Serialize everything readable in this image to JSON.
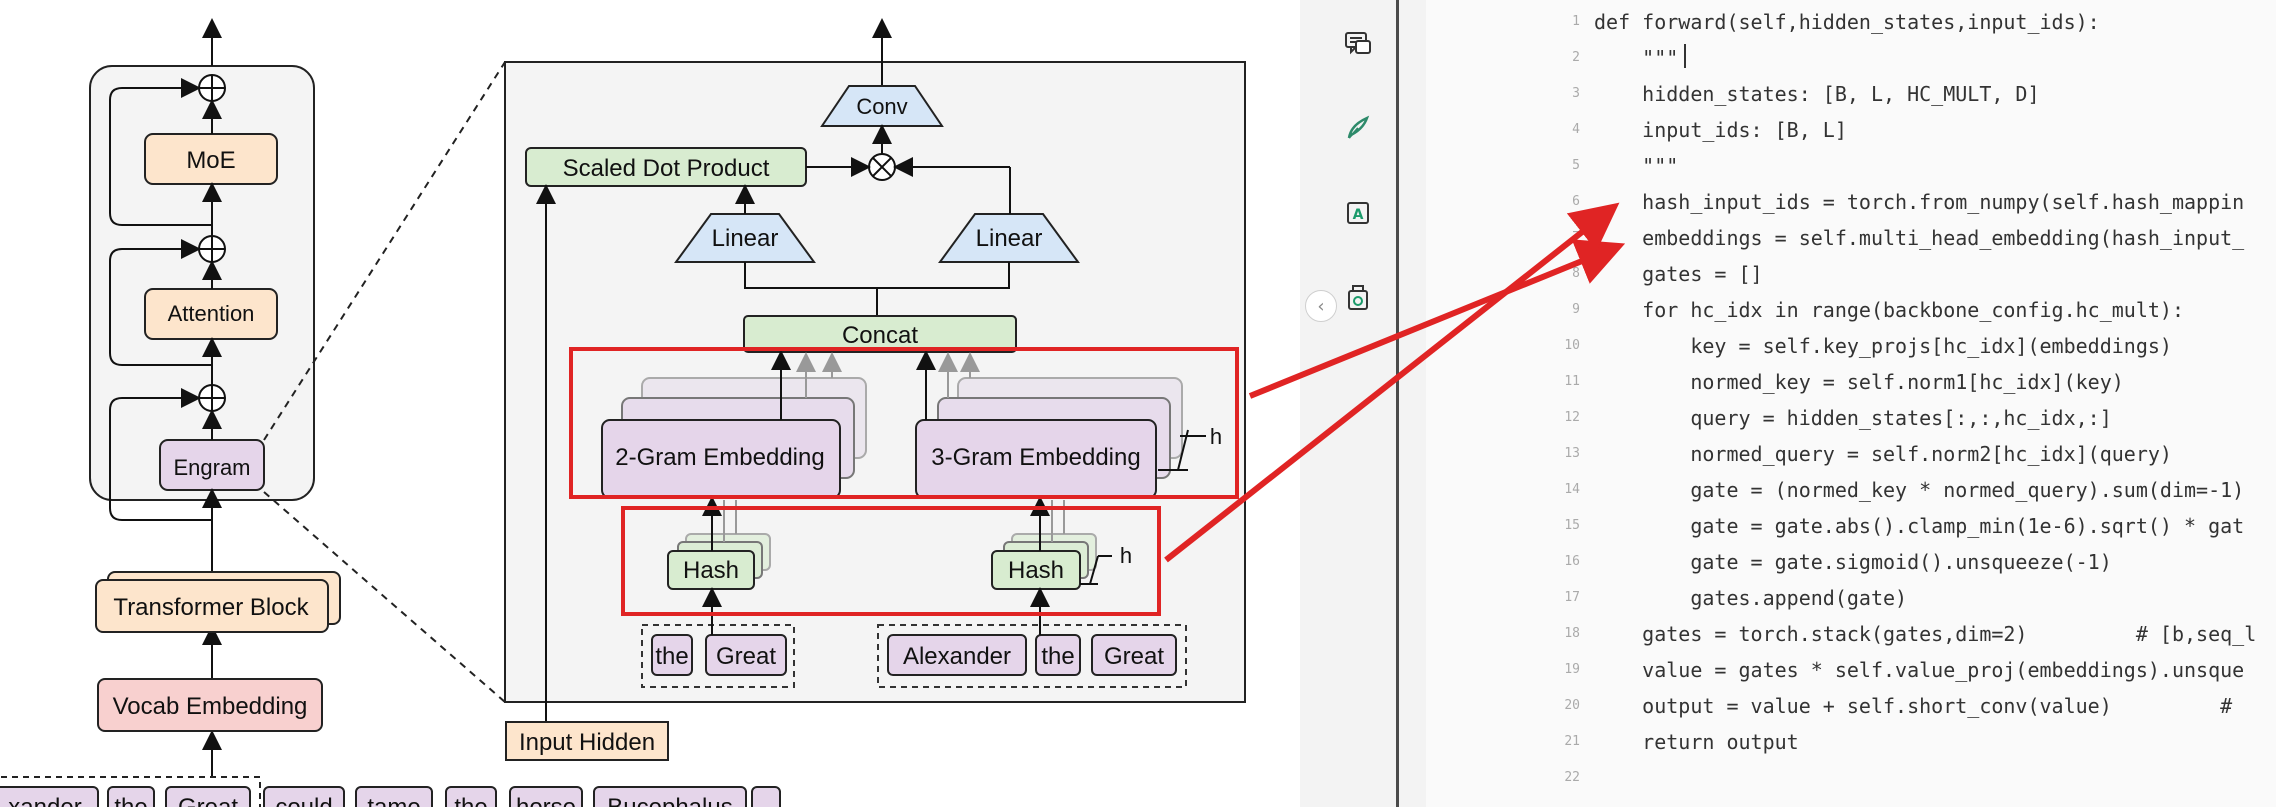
{
  "diagram": {
    "outer_arch": {
      "moe": "MoE",
      "attention": "Attention",
      "engram": "Engram",
      "transformer_block": "Transformer Block",
      "vocab_embedding": "Vocab Embedding",
      "add_symbol": "⊕"
    },
    "sentence_tokens": [
      "xander",
      "the",
      "Great",
      "could",
      "tame",
      "the",
      "horse",
      "Bucephalus",
      ""
    ],
    "engram_detail": {
      "conv": "Conv",
      "scaled_dot_product": "Scaled Dot Product",
      "multiply_symbol": "⊗",
      "linear_left": "Linear",
      "linear_right": "Linear",
      "concat": "Concat",
      "gram2_embedding": "2-Gram Embedding",
      "gram3_embedding": "3-Gram Embedding",
      "h_label_embedding": "h",
      "hash_left": "Hash",
      "hash_right": "Hash",
      "h_label_hash": "h",
      "tokens_left": [
        "the",
        "Great"
      ],
      "tokens_right": [
        "Alexander",
        "the",
        "Great"
      ],
      "input_hidden": "Input Hidden"
    },
    "colors": {
      "highlight": "#e02424",
      "orange_block": "#fde5cc",
      "purple_block": "#e5d5ea",
      "green_block": "#d8ecd0",
      "blue_block": "#d6e6f7",
      "red_block": "#f8d0cf"
    }
  },
  "sidebar_tools": [
    {
      "icon": "comment-icon"
    },
    {
      "icon": "highlighter-icon"
    },
    {
      "icon": "text-box-icon"
    },
    {
      "icon": "translate-icon"
    }
  ],
  "code": {
    "lines": [
      {
        "n": "1",
        "text": "def forward(self,hidden_states,input_ids):"
      },
      {
        "n": "2",
        "text": "    \"\"\""
      },
      {
        "n": "3",
        "text": "    hidden_states: [B, L, HC_MULT, D]"
      },
      {
        "n": "4",
        "text": "    input_ids: [B, L]"
      },
      {
        "n": "5",
        "text": "    \"\"\""
      },
      {
        "n": "6",
        "text": "    hash_input_ids = torch.from_numpy(self.hash_mappin"
      },
      {
        "n": "7",
        "text": "    embeddings = self.multi_head_embedding(hash_input_"
      },
      {
        "n": "8",
        "text": "    gates = []"
      },
      {
        "n": "9",
        "text": "    for hc_idx in range(backbone_config.hc_mult):"
      },
      {
        "n": "10",
        "text": "        key = self.key_projs[hc_idx](embeddings)"
      },
      {
        "n": "11",
        "text": "        normed_key = self.norm1[hc_idx](key)"
      },
      {
        "n": "12",
        "text": "        query = hidden_states[:,:,hc_idx,:]"
      },
      {
        "n": "13",
        "text": "        normed_query = self.norm2[hc_idx](query)"
      },
      {
        "n": "14",
        "text": "        gate = (normed_key * normed_query).sum(dim=-1)"
      },
      {
        "n": "15",
        "text": "        gate = gate.abs().clamp_min(1e-6).sqrt() * gat"
      },
      {
        "n": "16",
        "text": "        gate = gate.sigmoid().unsqueeze(-1)"
      },
      {
        "n": "17",
        "text": "        gates.append(gate)"
      },
      {
        "n": "18",
        "text": "    gates = torch.stack(gates,dim=2)         # [b,seq_l"
      },
      {
        "n": "19",
        "text": "    value = gates * self.value_proj(embeddings).unsque"
      },
      {
        "n": "20",
        "text": "    output = value + self.short_conv(value)         #"
      },
      {
        "n": "21",
        "text": "    return output"
      },
      {
        "n": "22",
        "text": ""
      }
    ]
  }
}
